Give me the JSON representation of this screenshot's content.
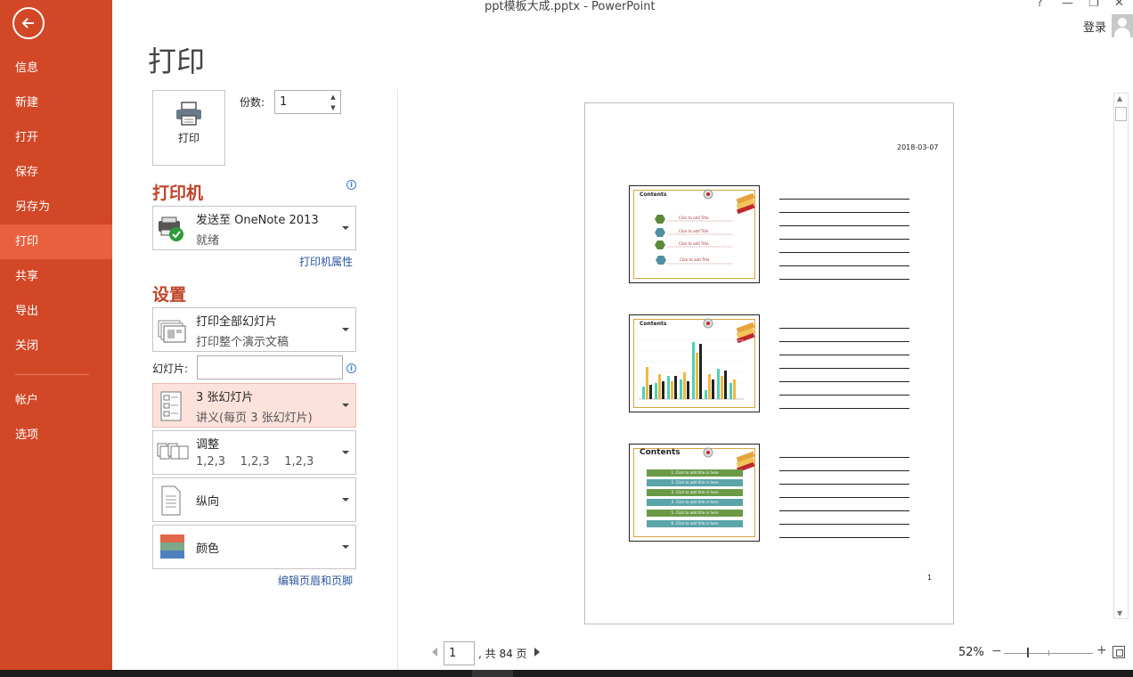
{
  "window": {
    "title": "ppt模板大成.pptx - PowerPoint",
    "help": "?",
    "minimize": "—",
    "restore": "❐",
    "close": "✕",
    "login": "登录"
  },
  "sidebar": {
    "items": [
      {
        "label": "信息"
      },
      {
        "label": "新建"
      },
      {
        "label": "打开"
      },
      {
        "label": "保存"
      },
      {
        "label": "另存为"
      },
      {
        "label": "打印"
      },
      {
        "label": "共享"
      },
      {
        "label": "导出"
      },
      {
        "label": "关闭"
      },
      {
        "label": "帐户"
      },
      {
        "label": "选项"
      }
    ]
  },
  "print": {
    "page_title": "打印",
    "button_label": "打印",
    "copies_label": "份数:",
    "copies_value": "1"
  },
  "printer": {
    "section_title": "打印机",
    "name": "发送至 OneNote 2013",
    "status": "就绪",
    "properties_link": "打印机属性"
  },
  "settings": {
    "section_title": "设置",
    "range_main": "打印全部幻灯片",
    "range_sub": "打印整个演示文稿",
    "slides_label": "幻灯片:",
    "slides_value": "",
    "layout_main": "3 张幻灯片",
    "layout_sub": "讲义(每页 3 张幻灯片)",
    "collate_main": "调整",
    "collate_sub": "1,2,3    1,2,3    1,2,3",
    "orientation": "纵向",
    "color": "颜色",
    "header_footer_link": "编辑页眉和页脚"
  },
  "preview": {
    "date": "2018-03-07",
    "page_number": "1",
    "thumb_titles": [
      "Contents",
      "Contents",
      "Contents"
    ],
    "thumb1_items": [
      "Click to add Title",
      "Click to add Title",
      "Click to add Title",
      "Click to add Title"
    ],
    "thumb3_items": [
      "1. Click to add title in here",
      "2. Click to add title in here",
      "3. Click to add title in here",
      "4. Click to add title in here",
      "5. Click to add title in here",
      "6. Click to add title in here"
    ]
  },
  "pager": {
    "current": "1",
    "total_text": ", 共 84 页"
  },
  "zoom": {
    "percent": "52%",
    "level_percent": 52,
    "minus": "−",
    "plus": "+"
  },
  "colors": {
    "sidebar": "#d24726",
    "sidebar_active": "#e9603f",
    "section_heading": "#c0432a",
    "link": "#2b579a",
    "highlight": "#fde2dc"
  }
}
